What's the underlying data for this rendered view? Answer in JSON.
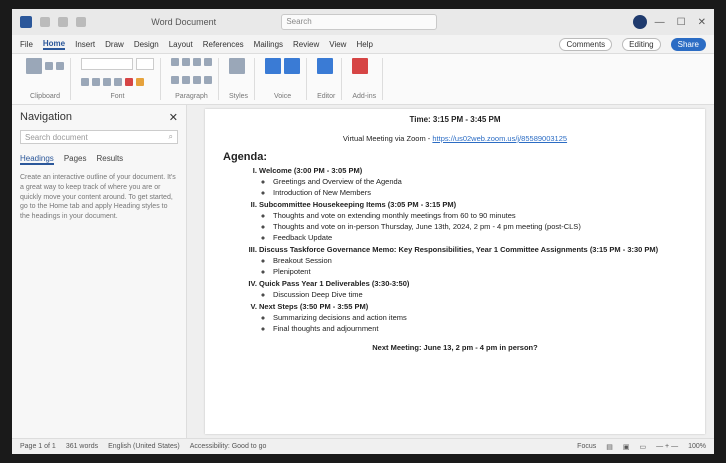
{
  "window": {
    "title": "Word Document",
    "search_placeholder": "Search",
    "controls": [
      "—",
      "☐",
      "✕"
    ]
  },
  "menu": {
    "tabs": [
      "File",
      "Home",
      "Insert",
      "Draw",
      "Design",
      "Layout",
      "References",
      "Mailings",
      "Review",
      "View",
      "Help"
    ],
    "active_tab": "Home",
    "comments": "Comments",
    "editing": "Editing",
    "share": "Share"
  },
  "ribbon": {
    "groups": [
      "Clipboard",
      "Font",
      "Paragraph",
      "Styles",
      "Voice",
      "Editor",
      "Add-ins"
    ]
  },
  "nav": {
    "title": "Navigation",
    "search_placeholder": "Search document",
    "tabs": [
      "Headings",
      "Pages",
      "Results"
    ],
    "hint": "Create an interactive outline of your document. It's a great way to keep track of where you are or quickly move your content around. To get started, go to the Home tab and apply Heading styles to the headings in your document."
  },
  "doc": {
    "time": "Time: 3:15 PM - 3:45 PM",
    "virtual_label": "Virtual Meeting via Zoom - ",
    "virtual_link": "https://us02web.zoom.us/j/85589003125",
    "agenda_title": "Agenda:",
    "items": [
      {
        "title": "Welcome (3:00 PM - 3:05 PM)",
        "subs": [
          "Greetings and Overview of the Agenda",
          "Introduction of New Members"
        ]
      },
      {
        "title": "Subcommittee Housekeeping Items (3:05 PM - 3:15 PM)",
        "subs": [
          "Thoughts and vote on extending monthly meetings from 60 to 90 minutes",
          "Thoughts and vote on in-person Thursday, June 13th, 2024, 2 pm - 4 pm meeting (post-CLS)",
          "Feedback Update"
        ]
      },
      {
        "title": "Discuss Taskforce Governance Memo: Key Responsibilities, Year 1 Committee Assignments (3:15 PM - 3:30 PM)",
        "subs": [
          "Breakout Session",
          "Plenipotent"
        ]
      },
      {
        "title": "Quick Pass Year 1 Deliverables (3:30-3:50)",
        "subs": [
          "Discussion Deep Dive time"
        ]
      },
      {
        "title": "Next Steps (3:50 PM - 3:55 PM)",
        "subs": [
          "Summarizing decisions and action items",
          "Final thoughts and adjournment"
        ]
      }
    ],
    "next_meeting": "Next Meeting: June 13, 2 pm - 4 pm in person?"
  },
  "status": {
    "page": "Page 1 of 1",
    "words": "361 words",
    "language": "English (United States)",
    "accessibility": "Accessibility: Good to go",
    "focus": "Focus",
    "zoom": "100%"
  }
}
